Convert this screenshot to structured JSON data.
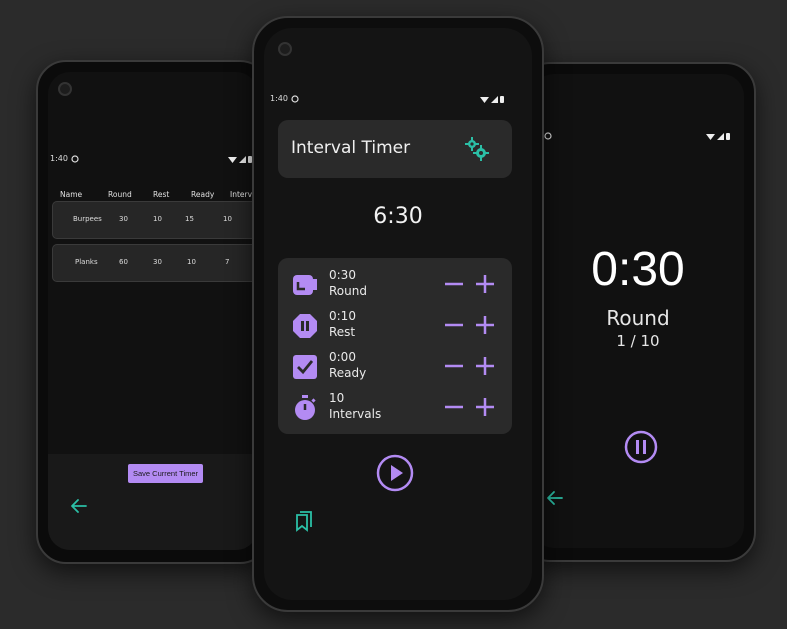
{
  "colors": {
    "accent_purple": "#b38bf3",
    "accent_teal": "#2bbfa6",
    "card_bg": "#2a2a2a"
  },
  "left": {
    "status_time": "1:40",
    "headers": [
      "Name",
      "Round",
      "Rest",
      "Ready",
      "Interva"
    ],
    "rows": [
      [
        "Burpees",
        "30",
        "10",
        "15",
        "10"
      ],
      [
        "Planks",
        "60",
        "30",
        "10",
        "7"
      ]
    ],
    "save_label": "Save Current Timer"
  },
  "center": {
    "status_time": "1:40",
    "title": "Interval Timer",
    "total_time": "6:30",
    "settings": [
      {
        "value": "0:30",
        "label": "Round"
      },
      {
        "value": "0:10",
        "label": "Rest"
      },
      {
        "value": "0:00",
        "label": "Ready"
      },
      {
        "value": "10",
        "label": "Intervals"
      }
    ]
  },
  "right": {
    "time": "0:30",
    "phase": "Round",
    "progress": "1 / 10"
  }
}
